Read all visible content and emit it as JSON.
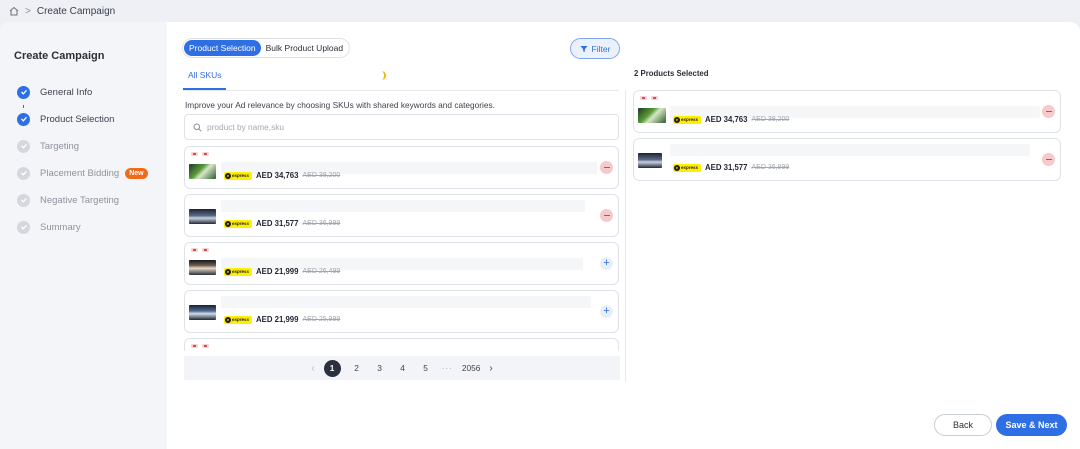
{
  "breadcrumb": {
    "home_icon": "home-icon",
    "separator": ">",
    "current": "Create Campaign"
  },
  "sidebar": {
    "title": "Create Campaign",
    "steps": [
      {
        "label": "General Info",
        "state": "done"
      },
      {
        "label": "Product Selection",
        "state": "done"
      },
      {
        "label": "Targeting",
        "state": "todo"
      },
      {
        "label": "Placement Bidding",
        "state": "todo",
        "badge": "New"
      },
      {
        "label": "Negative Targeting",
        "state": "todo"
      },
      {
        "label": "Summary",
        "state": "todo"
      }
    ]
  },
  "main": {
    "segments": [
      "Product Selection",
      "Bulk Product Upload"
    ],
    "filter_label": "Filter",
    "tab": "All SKUs",
    "hint": "Improve your Ad relevance by choosing SKUs with shared keywords and categories.",
    "search_placeholder": "product by name,sku",
    "products": [
      {
        "price": "AED 34,763",
        "old_price": "AED 38,200",
        "action": "remove",
        "has_tags": true
      },
      {
        "price": "AED 31,577",
        "old_price": "AED 36,999",
        "action": "remove",
        "has_tags": false
      },
      {
        "price": "AED 21,999",
        "old_price": "AED 26,499",
        "action": "add",
        "has_tags": true
      },
      {
        "price": "AED 21,999",
        "old_price": "AED 25,999",
        "action": "add",
        "has_tags": false
      }
    ],
    "pagination": {
      "pages": [
        "1",
        "2",
        "3",
        "4",
        "5"
      ],
      "ellipsis": "···",
      "last": "2056",
      "current": "1"
    },
    "selected_title": "2 Products Selected",
    "selected": [
      {
        "price": "AED 34,763",
        "old_price": "AED 38,200"
      },
      {
        "price": "AED 31,577",
        "old_price": "AED 36,999"
      }
    ],
    "express_label": "express"
  },
  "footer": {
    "back": "Back",
    "next": "Save & Next"
  },
  "colors": {
    "accent": "#2f6fe4",
    "badge": "#f26b1d",
    "express": "#feee00",
    "remove": "#d14753"
  }
}
